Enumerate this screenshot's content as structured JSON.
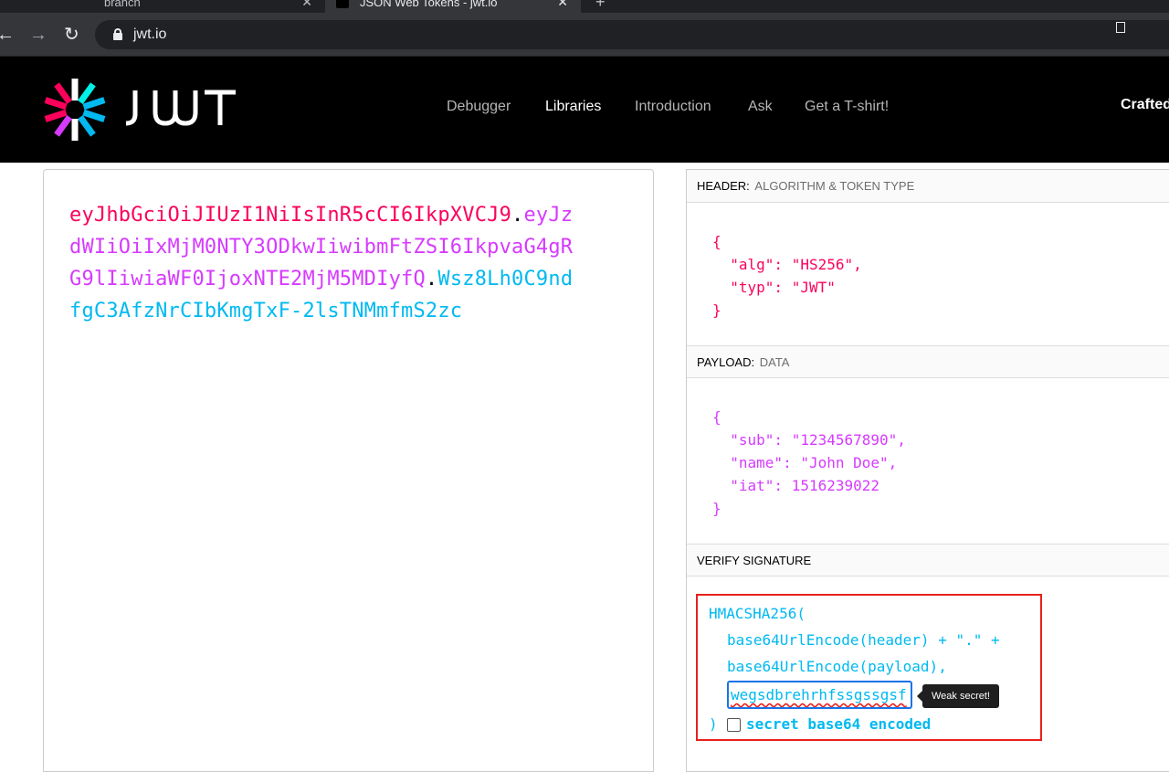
{
  "browser": {
    "tabs": [
      {
        "title": "branch"
      },
      {
        "title": "JSON Web Tokens - jwt.io"
      }
    ],
    "url": "jwt.io"
  },
  "site": {
    "logo_text": "JWT",
    "nav": [
      "Debugger",
      "Libraries",
      "Introduction",
      "Ask",
      "Get a T-shirt!"
    ],
    "active_nav": "Libraries",
    "crafted": "Crafted by"
  },
  "encoded": {
    "header_part": "eyJhbGciOiJIUzI1NiIsInR5cCI6IkpXVCJ9",
    "payload_part": "eyJzdWIiOiIxMjM0NTY3ODkwIiwibmFtZSI6IkpvaG4gRG9lIiwiaWF0IjoxNTE2MjM5MDIyfQ",
    "signature_part": "Wsz8Lh0C9ndfgC3AfzNrCIbKmgTxF-2lsTNMmfmS2zc",
    "dot": "."
  },
  "decoded": {
    "header_title": "HEADER:",
    "header_sub": "ALGORITHM & TOKEN TYPE",
    "header_json": "{\n  \"alg\": \"HS256\",\n  \"typ\": \"JWT\"\n}",
    "payload_title": "PAYLOAD:",
    "payload_sub": "DATA",
    "payload_json": "{\n  \"sub\": \"1234567890\",\n  \"name\": \"John Doe\",\n  \"iat\": 1516239022\n}",
    "verify_title": "VERIFY SIGNATURE"
  },
  "verify": {
    "line1": "HMACSHA256(",
    "line2": "base64UrlEncode(header) + \".\" +",
    "line3": "base64UrlEncode(payload),",
    "secret_value": "wegsdbrehrhfssgssgsf",
    "tooltip": "Weak secret!",
    "close_paren": ")",
    "checkbox_label": "secret base64 encoded"
  },
  "colors": {
    "header": "#fb015b",
    "payload": "#d63aff",
    "signature": "#00b9f1",
    "highlight_border": "#e8201b"
  }
}
